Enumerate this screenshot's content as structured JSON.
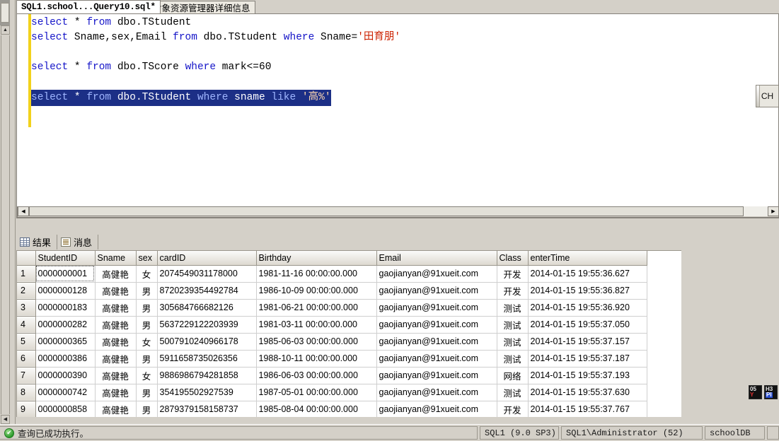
{
  "window": {
    "ime_chip": "CH"
  },
  "tabs": [
    {
      "label": "SQL1.school...Query10.sql*",
      "active": true
    },
    {
      "label": "对象资源管理器详细信息",
      "active": false
    }
  ],
  "editor": {
    "lines": [
      [
        {
          "t": "select",
          "c": "kw"
        },
        {
          "t": " * ",
          "c": ""
        },
        {
          "t": "from",
          "c": "kw"
        },
        {
          "t": " dbo.TStudent",
          "c": ""
        }
      ],
      [
        {
          "t": "select",
          "c": "kw"
        },
        {
          "t": " Sname,sex,Email ",
          "c": ""
        },
        {
          "t": "from",
          "c": "kw"
        },
        {
          "t": " dbo.TStudent ",
          "c": ""
        },
        {
          "t": "where",
          "c": "kw"
        },
        {
          "t": " Sname=",
          "c": ""
        },
        {
          "t": "'田育朋'",
          "c": "str"
        }
      ],
      [],
      [
        {
          "t": "select",
          "c": "kw"
        },
        {
          "t": " * ",
          "c": ""
        },
        {
          "t": "from",
          "c": "kw"
        },
        {
          "t": " dbo.TScore ",
          "c": ""
        },
        {
          "t": "where",
          "c": "kw"
        },
        {
          "t": " mark<=60",
          "c": ""
        }
      ],
      [],
      [
        {
          "t": "select",
          "c": "kw"
        },
        {
          "t": " * ",
          "c": ""
        },
        {
          "t": "from",
          "c": "kw"
        },
        {
          "t": " dbo.TStudent ",
          "c": ""
        },
        {
          "t": "where",
          "c": "kw"
        },
        {
          "t": " sname ",
          "c": ""
        },
        {
          "t": "like",
          "c": "kw"
        },
        {
          "t": " '高%'",
          "c": "str"
        }
      ]
    ],
    "selected_line_index": 5
  },
  "result_tabs": [
    {
      "label": "结果",
      "icon": "grid-icon"
    },
    {
      "label": "消息",
      "icon": "message-icon"
    }
  ],
  "grid": {
    "columns": [
      "StudentID",
      "Sname",
      "sex",
      "cardID",
      "Birthday",
      "Email",
      "Class",
      "enterTime"
    ],
    "rows": [
      {
        "n": "1",
        "StudentID": "0000000001",
        "Sname": "高健艳",
        "sex": "女",
        "cardID": "2074549031178000",
        "Birthday": "1981-11-16 00:00:00.000",
        "Email": "gaojianyan@91xueit.com",
        "Class": "开发",
        "enterTime": "2014-01-15 19:55:36.627"
      },
      {
        "n": "2",
        "StudentID": "0000000128",
        "Sname": "高健艳",
        "sex": "男",
        "cardID": "8720239354492784",
        "Birthday": "1986-10-09 00:00:00.000",
        "Email": "gaojianyan@91xueit.com",
        "Class": "开发",
        "enterTime": "2014-01-15 19:55:36.827"
      },
      {
        "n": "3",
        "StudentID": "0000000183",
        "Sname": "高健艳",
        "sex": "男",
        "cardID": "305684766682126",
        "Birthday": "1981-06-21 00:00:00.000",
        "Email": "gaojianyan@91xueit.com",
        "Class": "测试",
        "enterTime": "2014-01-15 19:55:36.920"
      },
      {
        "n": "4",
        "StudentID": "0000000282",
        "Sname": "高健艳",
        "sex": "男",
        "cardID": "5637229122203939",
        "Birthday": "1981-03-11 00:00:00.000",
        "Email": "gaojianyan@91xueit.com",
        "Class": "测试",
        "enterTime": "2014-01-15 19:55:37.050"
      },
      {
        "n": "5",
        "StudentID": "0000000365",
        "Sname": "高健艳",
        "sex": "女",
        "cardID": "5007910240966178",
        "Birthday": "1985-06-03 00:00:00.000",
        "Email": "gaojianyan@91xueit.com",
        "Class": "测试",
        "enterTime": "2014-01-15 19:55:37.157"
      },
      {
        "n": "6",
        "StudentID": "0000000386",
        "Sname": "高健艳",
        "sex": "男",
        "cardID": "5911658735026356",
        "Birthday": "1988-10-11 00:00:00.000",
        "Email": "gaojianyan@91xueit.com",
        "Class": "测试",
        "enterTime": "2014-01-15 19:55:37.187"
      },
      {
        "n": "7",
        "StudentID": "0000000390",
        "Sname": "高健艳",
        "sex": "女",
        "cardID": "9886986794281858",
        "Birthday": "1986-06-03 00:00:00.000",
        "Email": "gaojianyan@91xueit.com",
        "Class": "网络",
        "enterTime": "2014-01-15 19:55:37.193"
      },
      {
        "n": "8",
        "StudentID": "0000000742",
        "Sname": "高健艳",
        "sex": "男",
        "cardID": "354195502927539",
        "Birthday": "1987-05-01 00:00:00.000",
        "Email": "gaojianyan@91xueit.com",
        "Class": "测试",
        "enterTime": "2014-01-15 19:55:37.630"
      },
      {
        "n": "9",
        "StudentID": "0000000858",
        "Sname": "高健艳",
        "sex": "男",
        "cardID": "2879379158158737",
        "Birthday": "1985-08-04 00:00:00.000",
        "Email": "gaojianyan@91xueit.com",
        "Class": "开发",
        "enterTime": "2014-01-15 19:55:37.767"
      }
    ]
  },
  "statusbar": {
    "message": "查询已成功执行。",
    "server": "SQL1 (9.0 SP3)",
    "user": "SQL1\\Administrator (52)",
    "database": "schoolDB"
  }
}
